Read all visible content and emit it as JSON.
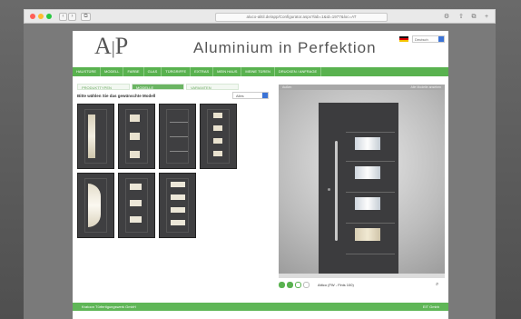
{
  "browser": {
    "url": "aluco-alitil.de/app/Configurator.aspx?lab=1&id=1977&loc=AT",
    "nav": [
      "‹",
      "›",
      "⧉"
    ],
    "tools": [
      "⚙",
      "⇧",
      "⧉",
      "+"
    ]
  },
  "site": {
    "title": "Aluminium in Perfektion",
    "language": "Deutsch",
    "menu": [
      "HAUSTÜRE",
      "MODELL",
      "FARBE",
      "GLAS",
      "TÜRGRIFFE",
      "EXTRAS",
      "MEIN HAUS",
      "MEINE TÜREN",
      "DRUCKEN / ANFRAGE"
    ],
    "tabs": [
      "PRODUKTTYPEN",
      "MODELLE",
      "VARIANTEN"
    ],
    "active_tab": 1,
    "prompt": "Bitte wählen Sie das gewünschte Modell",
    "filter": "Alles",
    "preview_header_left": "Außen",
    "preview_header_right": "Alle Modelle ansehen",
    "selected_model": "Attico (FW - Finis 100)",
    "footer_left": "Kratoon Türfertigungswerk GmbH",
    "footer_right": "EIT Gmbh"
  }
}
